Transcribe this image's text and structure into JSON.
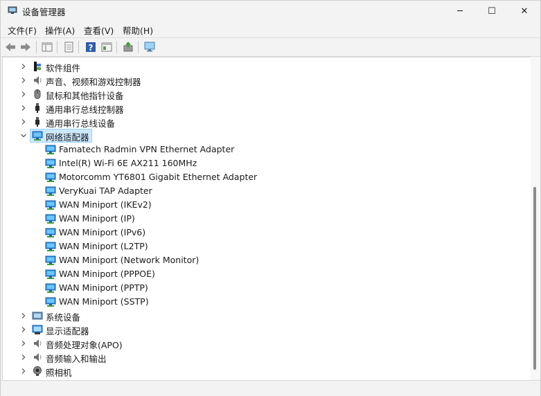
{
  "window": {
    "title": "设备管理器",
    "controls": {
      "minimize": "─",
      "maximize": "☐",
      "close": "✕"
    }
  },
  "menu": {
    "items": [
      {
        "label": "文件(F)"
      },
      {
        "label": "操作(A)"
      },
      {
        "label": "查看(V)"
      },
      {
        "label": "帮助(H)"
      }
    ]
  },
  "toolbar": {
    "buttons": [
      "back-icon",
      "forward-icon",
      "show-hide-tree-icon",
      "properties-icon",
      "help-icon",
      "view-icon",
      "update-driver-icon",
      "scan-hardware-icon"
    ]
  },
  "tree": {
    "categories_top": [
      {
        "label": "软件组件",
        "icon": "software-component-icon",
        "expanded": false
      },
      {
        "label": "声音、视频和游戏控制器",
        "icon": "speaker-icon",
        "expanded": false
      },
      {
        "label": "鼠标和其他指针设备",
        "icon": "mouse-icon",
        "expanded": false
      },
      {
        "label": "通用串行总线控制器",
        "icon": "usb-icon",
        "expanded": false
      },
      {
        "label": "通用串行总线设备",
        "icon": "usb-icon",
        "expanded": false
      }
    ],
    "network": {
      "label": "网络适配器",
      "icon": "network-adapter-icon",
      "expanded": true,
      "selected": true,
      "children": [
        {
          "label": "Famatech Radmin VPN Ethernet Adapter"
        },
        {
          "label": "Intel(R) Wi-Fi 6E AX211 160MHz"
        },
        {
          "label": "Motorcomm YT6801 Gigabit Ethernet Adapter"
        },
        {
          "label": "VeryKuai TAP Adapter"
        },
        {
          "label": "WAN Miniport (IKEv2)"
        },
        {
          "label": "WAN Miniport (IP)"
        },
        {
          "label": "WAN Miniport (IPv6)"
        },
        {
          "label": "WAN Miniport (L2TP)"
        },
        {
          "label": "WAN Miniport (Network Monitor)"
        },
        {
          "label": "WAN Miniport (PPPOE)"
        },
        {
          "label": "WAN Miniport (PPTP)"
        },
        {
          "label": "WAN Miniport (SSTP)"
        }
      ]
    },
    "categories_bottom": [
      {
        "label": "系统设备",
        "icon": "system-device-icon",
        "expanded": false
      },
      {
        "label": "显示适配器",
        "icon": "display-adapter-icon",
        "expanded": false
      },
      {
        "label": "音频处理对象(APO)",
        "icon": "speaker-icon",
        "expanded": false
      },
      {
        "label": "音频输入和输出",
        "icon": "speaker-icon",
        "expanded": false
      },
      {
        "label": "照相机",
        "icon": "camera-icon",
        "expanded": false
      }
    ]
  },
  "colors": {
    "selection_bg": "#cce8ff",
    "selection_border": "#99d1ff",
    "network_icon": "#1e88e5"
  }
}
